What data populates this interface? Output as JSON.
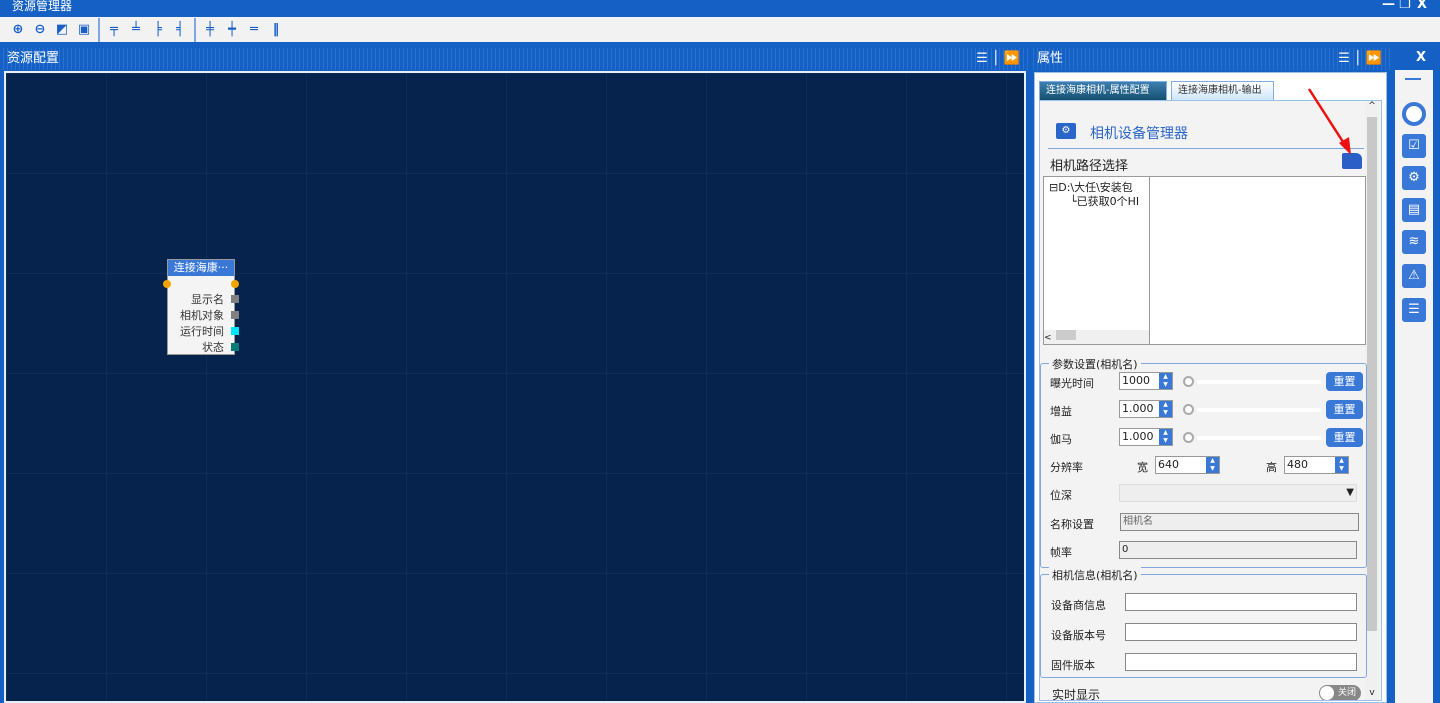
{
  "window": {
    "title": "资源管理器",
    "minimize": "—",
    "restore": "❐",
    "close": "X"
  },
  "toolbar": {
    "icons": [
      "zoom-in",
      "zoom-out",
      "fit",
      "fullscreen",
      "align-top",
      "align-bottom",
      "align-left",
      "align-right",
      "center-horizontal",
      "center-vertical",
      "distribute-horizontal",
      "distribute-vertical"
    ]
  },
  "left_panel": {
    "title": "资源配置",
    "menu": "☰",
    "pin": "⏩"
  },
  "node": {
    "title": "连接海康···",
    "ports": [
      "显示名",
      "相机对象",
      "运行时间",
      "状态"
    ],
    "port_colors": [
      "#808080",
      "#808080",
      "#00e5ff",
      "#0a7a78"
    ]
  },
  "right_panel": {
    "title": "属性",
    "menu": "☰",
    "pin": "⏩",
    "close": "X",
    "tabs": [
      "连接海康相机-属性配置",
      "连接海康相机-输出"
    ],
    "header": "相机设备管理器",
    "path_label": "相机路径选择",
    "tree": {
      "root": "D:\\大任\\安装包",
      "child": "已获取0个HI"
    },
    "params": {
      "title": "参数设置(相机名)",
      "exposure_label": "曝光时间",
      "exposure": "1000",
      "gain_label": "增益",
      "gain": "1.000",
      "gamma_label": "伽马",
      "gamma": "1.000",
      "reset": "重置",
      "resolution_label": "分辨率",
      "width_label": "宽",
      "width": "640",
      "height_label": "高",
      "height": "480",
      "bitdepth_label": "位深",
      "bitdepth": "",
      "name_label": "名称设置",
      "name_placeholder": "相机名",
      "fps_label": "帧率",
      "fps": "0"
    },
    "info": {
      "title": "相机信息(相机名)",
      "vendor_label": "设备商信息",
      "version_label": "设备版本号",
      "firmware_label": "固件版本"
    },
    "live": {
      "label": "实时显示",
      "toggle": "关闭"
    }
  },
  "sidebar": {
    "collapse": "—"
  }
}
